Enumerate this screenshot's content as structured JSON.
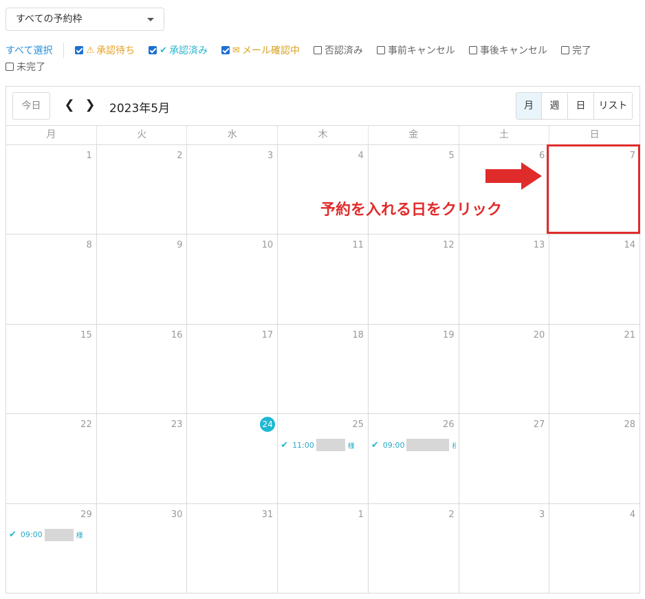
{
  "frame_select": {
    "label": "すべての予約枠"
  },
  "filters": {
    "select_all": "すべて選択",
    "items": [
      {
        "label": "承認待ち",
        "checked": true,
        "icon": "warning-icon",
        "color": "#e8a020"
      },
      {
        "label": "承認済み",
        "checked": true,
        "icon": "check-icon",
        "color": "#26b5cf"
      },
      {
        "label": "メール確認中",
        "checked": true,
        "icon": "envelope-icon",
        "color": "#d9a21a"
      },
      {
        "label": "否認済み",
        "checked": false,
        "color": "#666666"
      },
      {
        "label": "事前キャンセル",
        "checked": false,
        "color": "#666666"
      },
      {
        "label": "事後キャンセル",
        "checked": false,
        "color": "#666666"
      },
      {
        "label": "完了",
        "checked": false,
        "color": "#666666"
      },
      {
        "label": "未完了",
        "checked": false,
        "color": "#666666"
      }
    ]
  },
  "calendar": {
    "today_label": "今日",
    "prev_icon": "chevron-left-icon",
    "next_icon": "chevron-right-icon",
    "month_title": "2023年5月",
    "views": [
      {
        "label": "月",
        "active": true
      },
      {
        "label": "週",
        "active": false
      },
      {
        "label": "日",
        "active": false
      },
      {
        "label": "リスト",
        "active": false
      }
    ],
    "weekdays": [
      "月",
      "火",
      "水",
      "木",
      "金",
      "土",
      "日"
    ],
    "weeks": [
      [
        "1",
        "2",
        "3",
        "4",
        "5",
        "6",
        "7"
      ],
      [
        "8",
        "9",
        "10",
        "11",
        "12",
        "13",
        "14"
      ],
      [
        "15",
        "16",
        "17",
        "18",
        "19",
        "20",
        "21"
      ],
      [
        "22",
        "23",
        "24",
        "25",
        "26",
        "27",
        "28"
      ],
      [
        "29",
        "30",
        "31",
        "1",
        "2",
        "3",
        "4"
      ]
    ],
    "today_date": "24",
    "events": [
      {
        "week": 3,
        "day": 3,
        "time": "11:00",
        "suffix": "様"
      },
      {
        "week": 3,
        "day": 4,
        "time": "09:00",
        "suffix": "様"
      },
      {
        "week": 4,
        "day": 0,
        "time": "09:00",
        "suffix": "様"
      }
    ]
  },
  "annotation": {
    "text": "予約を入れる日をクリック",
    "color": "#e02b2b"
  }
}
